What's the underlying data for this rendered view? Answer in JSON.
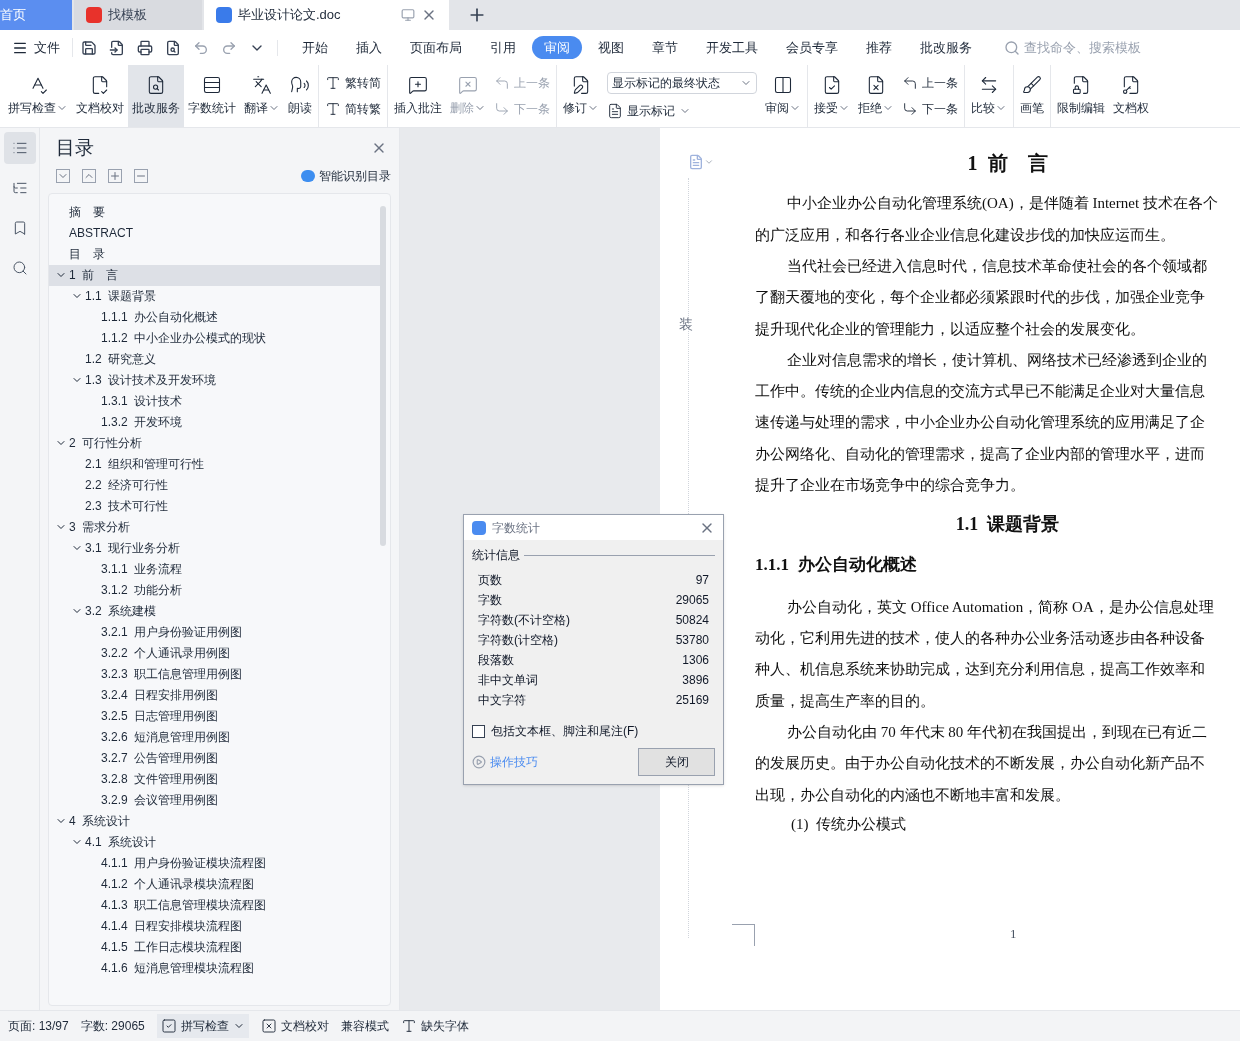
{
  "window_tabs": [
    {
      "kind": "home",
      "label": "首页",
      "selected": false
    },
    {
      "kind": "app",
      "label": "找模板",
      "selected": false
    },
    {
      "kind": "doc",
      "label": "毕业设计论文.doc",
      "selected": true
    }
  ],
  "menu": {
    "file": "文件",
    "tabs": [
      {
        "label": "开始",
        "selected": false
      },
      {
        "label": "插入",
        "selected": false
      },
      {
        "label": "页面布局",
        "selected": false
      },
      {
        "label": "引用",
        "selected": false
      },
      {
        "label": "审阅",
        "selected": true
      },
      {
        "label": "视图",
        "selected": false
      },
      {
        "label": "章节",
        "selected": false
      },
      {
        "label": "开发工具",
        "selected": false
      },
      {
        "label": "会员专享",
        "selected": false
      },
      {
        "label": "推荐",
        "selected": false
      },
      {
        "label": "批改服务",
        "selected": false
      }
    ],
    "search": {
      "placeholder": "查找命令、搜索模板"
    }
  },
  "ribbon": {
    "groups": [
      [
        {
          "kind": "big",
          "label": "拼写检查",
          "caret": true,
          "disabled": false,
          "selected": false
        },
        {
          "kind": "big",
          "label": "文档校对",
          "caret": false,
          "disabled": false,
          "selected": false
        },
        {
          "kind": "big",
          "label": "批改服务",
          "caret": false,
          "disabled": false,
          "selected": true
        },
        {
          "kind": "big",
          "label": "字数统计",
          "caret": false,
          "disabled": false,
          "selected": false
        },
        {
          "kind": "big",
          "label": "翻译",
          "caret": true,
          "disabled": false,
          "selected": false
        },
        {
          "kind": "big",
          "label": "朗读",
          "caret": false,
          "disabled": false,
          "selected": false
        }
      ],
      [
        {
          "kind": "pair",
          "items": [
            {
              "label": "繁转简",
              "disabled": false
            },
            {
              "label": "简转繁",
              "disabled": false
            }
          ]
        }
      ],
      [
        {
          "kind": "big",
          "label": "插入批注",
          "caret": false,
          "disabled": false,
          "selected": false
        },
        {
          "kind": "big",
          "label": "删除",
          "caret": true,
          "disabled": true,
          "selected": false
        },
        {
          "kind": "pair",
          "items": [
            {
              "label": "上一条",
              "disabled": true
            },
            {
              "label": "下一条",
              "disabled": true
            }
          ]
        }
      ],
      [
        {
          "kind": "big",
          "label": "修订",
          "caret": true,
          "disabled": false,
          "selected": false
        },
        {
          "kind": "select",
          "value": "显示标记的最终状态",
          "label": "显示标记",
          "caret": true
        },
        {
          "kind": "big",
          "label": "审阅",
          "caret": true,
          "disabled": false,
          "selected": false
        }
      ],
      [
        {
          "kind": "big",
          "label": "接受",
          "caret": true,
          "disabled": false,
          "selected": false
        },
        {
          "kind": "big",
          "label": "拒绝",
          "caret": true,
          "disabled": false,
          "selected": false
        },
        {
          "kind": "pair",
          "items": [
            {
              "label": "上一条",
              "disabled": false
            },
            {
              "label": "下一条",
              "disabled": false
            }
          ]
        }
      ],
      [
        {
          "kind": "big",
          "label": "比较",
          "caret": true,
          "disabled": false,
          "selected": false
        }
      ],
      [
        {
          "kind": "big",
          "label": "画笔",
          "caret": false,
          "disabled": false,
          "selected": false
        }
      ],
      [
        {
          "kind": "big",
          "label": "限制编辑",
          "caret": false,
          "disabled": false,
          "selected": false
        },
        {
          "kind": "big",
          "label": "文档权",
          "caret": false,
          "disabled": false,
          "selected": false
        }
      ]
    ]
  },
  "side_icons": [
    {
      "selected": true
    },
    {
      "selected": false
    },
    {
      "selected": false
    },
    {
      "selected": false
    }
  ],
  "toc": {
    "title": "目录",
    "smart_button": "智能识别目录",
    "items": [
      {
        "label": "摘　要",
        "selected": false
      },
      {
        "label": "ABSTRACT",
        "selected": false
      },
      {
        "label": "目　录",
        "selected": false
      },
      {
        "label": "1  前　言",
        "selected": true,
        "expanded": true,
        "children": [
          {
            "label": "1.1  课题背景",
            "selected": false,
            "expanded": true,
            "children": [
              {
                "label": "1.1.1  办公自动化概述",
                "selected": false
              },
              {
                "label": "1.1.2  中小企业办公模式的现状",
                "selected": false
              }
            ]
          },
          {
            "label": "1.2  研究意义",
            "selected": false
          },
          {
            "label": "1.3  设计技术及开发环境",
            "selected": false,
            "expanded": true,
            "children": [
              {
                "label": "1.3.1  设计技术",
                "selected": false
              },
              {
                "label": "1.3.2  开发环境",
                "selected": false
              }
            ]
          }
        ]
      },
      {
        "label": "2  可行性分析",
        "selected": false,
        "expanded": true,
        "children": [
          {
            "label": "2.1  组织和管理可行性",
            "selected": false
          },
          {
            "label": "2.2  经济可行性",
            "selected": false
          },
          {
            "label": "2.3  技术可行性",
            "selected": false
          }
        ]
      },
      {
        "label": "3  需求分析",
        "selected": false,
        "expanded": true,
        "children": [
          {
            "label": "3.1  现行业务分析",
            "selected": false,
            "expanded": true,
            "children": [
              {
                "label": "3.1.1  业务流程",
                "selected": false
              },
              {
                "label": "3.1.2  功能分析",
                "selected": false
              }
            ]
          },
          {
            "label": "3.2  系统建模",
            "selected": false,
            "expanded": true,
            "children": [
              {
                "label": "3.2.1  用户身份验证用例图",
                "selected": false
              },
              {
                "label": "3.2.2  个人通讯录用例图",
                "selected": false
              },
              {
                "label": "3.2.3  职工信息管理用例图",
                "selected": false
              },
              {
                "label": "3.2.4  日程安排用例图",
                "selected": false
              },
              {
                "label": "3.2.5  日志管理用例图",
                "selected": false
              },
              {
                "label": "3.2.6  短消息管理用例图",
                "selected": false
              },
              {
                "label": "3.2.7  公告管理用例图",
                "selected": false
              },
              {
                "label": "3.2.8  文件管理用例图",
                "selected": false
              },
              {
                "label": "3.2.9  会议管理用例图",
                "selected": false
              }
            ]
          }
        ]
      },
      {
        "label": "4  系统设计",
        "selected": false,
        "expanded": true,
        "children": [
          {
            "label": "4.1  系统设计",
            "selected": false,
            "expanded": true,
            "children": [
              {
                "label": "4.1.1  用户身份验证模块流程图",
                "selected": false
              },
              {
                "label": "4.1.2  个人通讯录模块流程图",
                "selected": false
              },
              {
                "label": "4.1.3  职工信息管理模块流程图",
                "selected": false
              },
              {
                "label": "4.1.4  日程安排模块流程图",
                "selected": false
              },
              {
                "label": "4.1.5  工作日志模块流程图",
                "selected": false
              },
              {
                "label": "4.1.6  短消息管理模块流程图",
                "selected": false
              }
            ]
          }
        ]
      }
    ]
  },
  "document": {
    "margin_mark": "装",
    "page_number": "1",
    "blocks": [
      {
        "kind": "title",
        "text": "1  前　言"
      },
      {
        "kind": "paragraph",
        "lines": [
          "中小企业办公自动化管理系统(OA)，是伴随着 Internet 技术在各个",
          "的广泛应用，和各行各业企业信息化建设步伐的加快应运而生。"
        ]
      },
      {
        "kind": "paragraph",
        "lines": [
          "当代社会已经进入信息时代，信息技术革命使社会的各个领域都",
          "了翻天覆地的变化，每个企业都必须紧跟时代的步伐，加强企业竞争",
          "提升现代化企业的管理能力，以适应整个社会的发展变化。"
        ]
      },
      {
        "kind": "paragraph",
        "lines": [
          "企业对信息需求的增长，使计算机、网络技术已经渗透到企业的",
          "工作中。传统的企业内信息的交流方式早已不能满足企业对大量信息",
          "速传递与处理的需求，中小企业办公自动化管理系统的应用满足了企",
          "办公网络化、自动化的管理需求，提高了企业内部的管理水平，进而",
          "提升了企业在市场竞争中的综合竞争力。"
        ]
      },
      {
        "kind": "heading2",
        "text": "1.1  课题背景"
      },
      {
        "kind": "heading3",
        "text": "1.1.1  办公自动化概述"
      },
      {
        "kind": "paragraph",
        "lines": [
          "办公自动化，英文 Office Automation，简称 OA，是办公信息处理",
          "动化，它利用先进的技术，使人的各种办公业务活动逐步由各种设备",
          "种人、机信息系统来协助完成，达到充分利用信息，提高工作效率和",
          "质量，提高生产率的目的。"
        ]
      },
      {
        "kind": "paragraph",
        "lines": [
          "办公自动化由 70 年代末 80 年代初在我国提出，到现在已有近二",
          "的发展历史。由于办公自动化技术的不断发展，办公自动化新产品不",
          "出现，办公自动化的内涵也不断地丰富和发展。"
        ]
      },
      {
        "kind": "item",
        "text": "(1)  传统办公模式"
      }
    ]
  },
  "dialog": {
    "title": "字数统计",
    "group": "统计信息",
    "rows": [
      {
        "label": "页数",
        "value": "97"
      },
      {
        "label": "字数",
        "value": "29065"
      },
      {
        "label": "字符数(不计空格)",
        "value": "50824"
      },
      {
        "label": "字符数(计空格)",
        "value": "53780"
      },
      {
        "label": "段落数",
        "value": "1306"
      },
      {
        "label": "非中文单词",
        "value": "3896"
      },
      {
        "label": "中文字符",
        "value": "25169"
      }
    ],
    "checkbox": {
      "label": "包括文本框、脚注和尾注(F)",
      "checked": false
    },
    "link": "操作技巧",
    "button": "关闭"
  },
  "status_bar": {
    "page": "页面: 13/97",
    "words": "字数: 29065",
    "spell": "拼写检查",
    "proof": "文档校对",
    "mode": "兼容模式",
    "font": "缺失字体"
  }
}
